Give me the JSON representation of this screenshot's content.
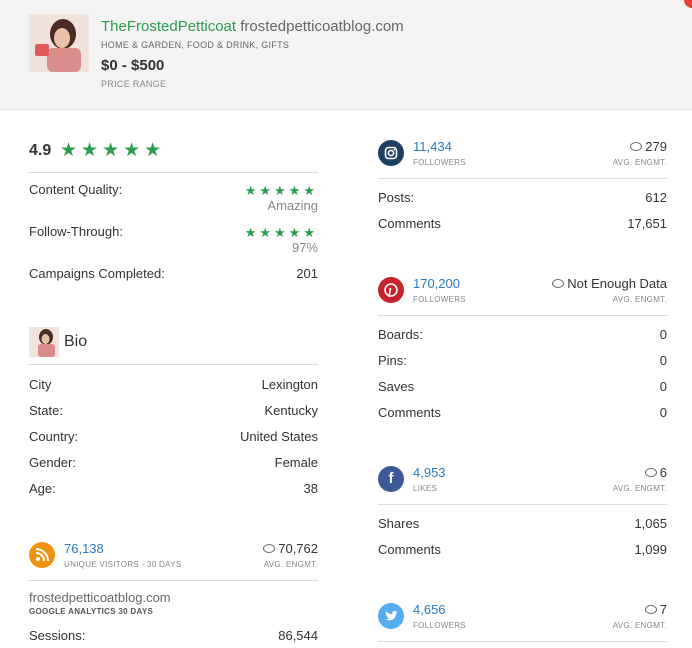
{
  "profile": {
    "handle": "TheFrostedPetticoat",
    "site": "frostedpetticoatblog.com",
    "categories": "HOME & GARDEN, FOOD & DRINK, GIFTS",
    "price": "$0 - $500",
    "price_label": "PRICE RANGE"
  },
  "ratings": {
    "overall": "4.9",
    "content_quality_label": "Content Quality:",
    "content_quality_value": "Amazing",
    "follow_through_label": "Follow-Through:",
    "follow_through_value": "97%",
    "campaigns_label": "Campaigns Completed:",
    "campaigns_value": "201",
    "stars": "★★★★★",
    "overall_level": 4.9
  },
  "bio": {
    "title": "Bio",
    "rows": [
      {
        "k": "City",
        "v": "Lexington"
      },
      {
        "k": "State:",
        "v": "Kentucky"
      },
      {
        "k": "Country:",
        "v": "United States"
      },
      {
        "k": "Gender:",
        "v": "Female"
      },
      {
        "k": "Age:",
        "v": "38"
      }
    ]
  },
  "blog": {
    "metric": "76,138",
    "metric_label": "UNIQUE VISITORS - 30 DAYS",
    "engagement": "70,762",
    "engagement_label": "AVG. ENGMT.",
    "site": "frostedpetticoatblog.com",
    "source": "GOOGLE ANALYTICS 30 DAYS",
    "sessions_label": "Sessions:",
    "sessions_value": "86,544"
  },
  "instagram": {
    "icon": "instagram-icon",
    "metric": "11,434",
    "metric_label": "FOLLOWERS",
    "engagement": "279",
    "engagement_label": "AVG. ENGMT.",
    "rows": [
      {
        "k": "Posts:",
        "v": "612"
      },
      {
        "k": "Comments",
        "v": "17,651"
      }
    ]
  },
  "pinterest": {
    "icon": "pinterest-icon",
    "metric": "170,200",
    "metric_label": "FOLLOWERS",
    "engagement": "Not Enough Data",
    "engagement_label": "AVG. ENGMT.",
    "rows": [
      {
        "k": "Boards:",
        "v": "0"
      },
      {
        "k": "Pins:",
        "v": "0"
      },
      {
        "k": "Saves",
        "v": "0"
      },
      {
        "k": "Comments",
        "v": "0"
      }
    ]
  },
  "facebook": {
    "icon": "facebook-icon",
    "metric": "4,953",
    "metric_label": "LIKES",
    "engagement": "6",
    "engagement_label": "AVG. ENGMT.",
    "rows": [
      {
        "k": "Shares",
        "v": "1,065"
      },
      {
        "k": "Comments",
        "v": "1,099"
      }
    ]
  },
  "twitter": {
    "icon": "twitter-icon",
    "metric": "4,656",
    "metric_label": "FOLLOWERS",
    "engagement": "7",
    "engagement_label": "AVG. ENGMT."
  },
  "colors": {
    "green": "#2a9d4e",
    "link_blue": "#2a7ac0",
    "instagram": "#1d3f63",
    "pinterest": "#c8232c",
    "facebook": "#3b5998",
    "twitter": "#55acee",
    "rss": "#f29111"
  }
}
